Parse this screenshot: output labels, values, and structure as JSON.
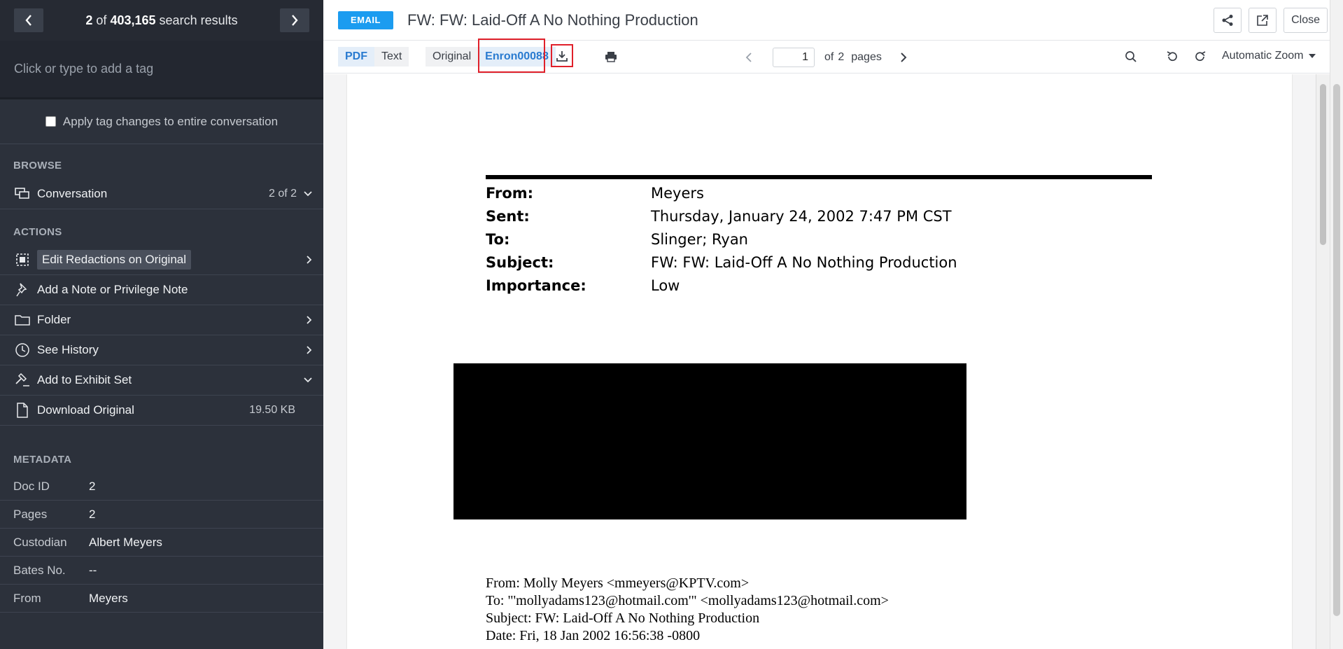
{
  "nav": {
    "position": "2",
    "of_word": "of",
    "total": "403,165",
    "suffix": "search results"
  },
  "tag": {
    "placeholder": "Click or type to add a tag"
  },
  "apply": {
    "label": "Apply tag changes to entire conversation"
  },
  "browse": {
    "label": "BROWSE",
    "conversation": {
      "label": "Conversation",
      "count": "2 of 2"
    }
  },
  "actions": {
    "label": "ACTIONS",
    "items": [
      {
        "label": "Edit Redactions on Original"
      },
      {
        "label": "Add a Note or Privilege Note"
      },
      {
        "label": "Folder"
      },
      {
        "label": "See History"
      },
      {
        "label": "Add to Exhibit Set"
      },
      {
        "label": "Download Original",
        "size": "19.50 KB"
      }
    ]
  },
  "metadata": {
    "label": "METADATA",
    "rows": [
      {
        "key": "Doc ID",
        "value": "2"
      },
      {
        "key": "Pages",
        "value": "2"
      },
      {
        "key": "Custodian",
        "value": "Albert Meyers"
      },
      {
        "key": "Bates No.",
        "value": "--"
      },
      {
        "key": "From",
        "value": "Meyers"
      }
    ]
  },
  "header": {
    "badge": "EMAIL",
    "title": "FW: FW: Laid-Off A No Nothing Production",
    "close_label": "Close"
  },
  "toolbar": {
    "view_tabs": [
      "PDF",
      "Text"
    ],
    "source_tabs": [
      "Original",
      "Enron00088"
    ],
    "page_current": "1",
    "page_of": "of",
    "page_total": "2",
    "page_suffix": "pages",
    "zoom": "Automatic Zoom"
  },
  "document": {
    "header": [
      {
        "key": "From:",
        "value": "Meyers"
      },
      {
        "key": "Sent:",
        "value": "Thursday, January 24, 2002 7:47 PM CST"
      },
      {
        "key": "To:",
        "value": "Slinger; Ryan"
      },
      {
        "key": "Subject:",
        "value": "FW: FW: Laid-Off A No Nothing Production"
      },
      {
        "key": "Importance:",
        "value": "Low"
      }
    ],
    "body": [
      "From: Molly Meyers <mmeyers@KPTV.com>",
      "To: \"'mollyadams123@hotmail.com'\" <mollyadams123@hotmail.com>",
      "Subject: FW: Laid-Off A No Nothing Production",
      "Date: Fri, 18 Jan 2002 16:56:38 -0800"
    ]
  },
  "colors": {
    "sidebar_bg": "#2c313b",
    "badge_blue": "#1b9cf0",
    "highlight_red": "#e0202a",
    "active_tab": "#2a7bd0"
  }
}
